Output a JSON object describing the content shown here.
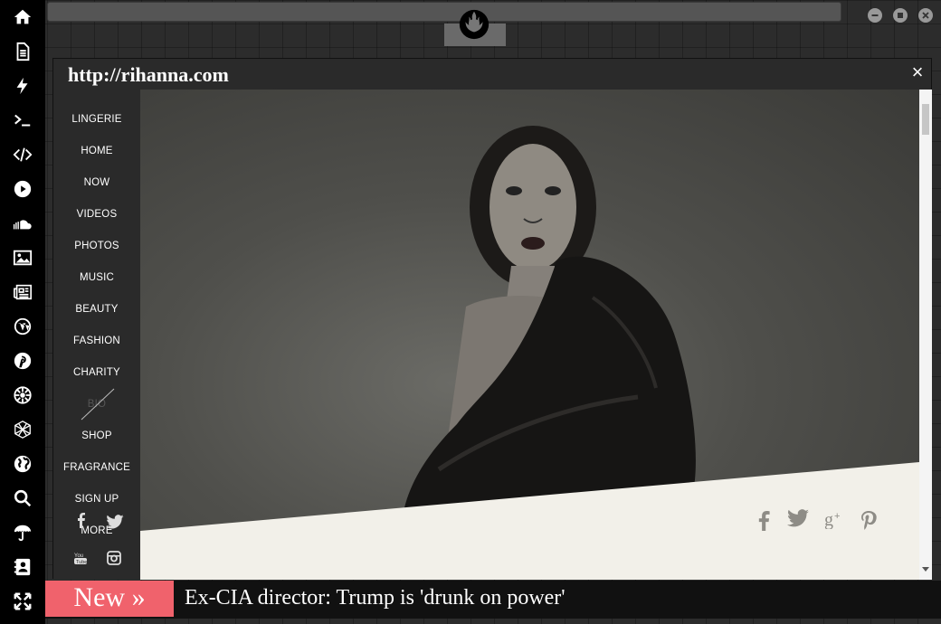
{
  "window": {
    "title": "http://rihanna.com",
    "close": "×"
  },
  "sidebar": {
    "icons": [
      "home-icon",
      "document-icon",
      "bolt-icon",
      "terminal-icon",
      "code-icon",
      "play-icon",
      "soundcloud-icon",
      "image-icon",
      "news-icon",
      "wordpress-icon",
      "pinterest-icon",
      "galactic-empire-icon",
      "hexagon-icon",
      "globe-icon",
      "search-icon",
      "umbrella-icon",
      "contacts-icon",
      "expand-icon"
    ]
  },
  "site_nav": {
    "items": [
      "LINGERIE",
      "HOME",
      "NOW",
      "VIDEOS",
      "PHOTOS",
      "MUSIC",
      "BEAUTY",
      "FASHION",
      "CHARITY",
      "BIO",
      "SHOP",
      "FRAGRANCE",
      "SIGN UP",
      "MORE"
    ]
  },
  "social": [
    "facebook-icon",
    "twitter-icon",
    "google-plus-icon",
    "pinterest-icon"
  ],
  "ticker": {
    "label": "New »",
    "headline": "Ex-CIA director: Trump is 'drunk on power'"
  },
  "colors": {
    "accent": "#f0626c",
    "sidebar_bg": "#000000",
    "ticker_bg": "#111111"
  }
}
